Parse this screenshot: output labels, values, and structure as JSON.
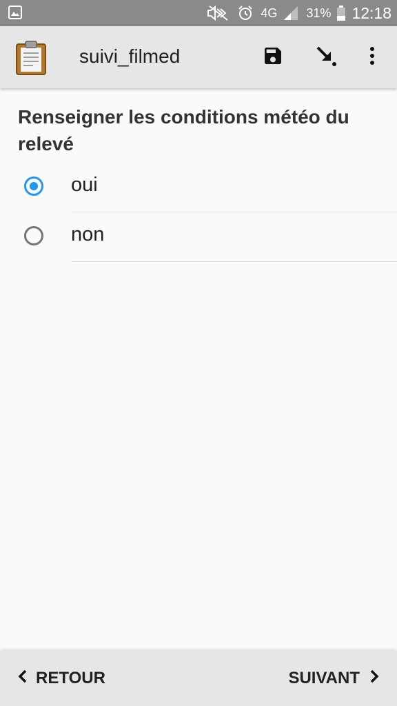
{
  "status_bar": {
    "network": "4G",
    "battery_percent": "31%",
    "time": "12:18",
    "icons": [
      "gallery-icon",
      "mute-icon",
      "alarm-icon",
      "signal-icon",
      "battery-icon"
    ]
  },
  "app_bar": {
    "title": "suivi_filmed",
    "icons": [
      "clipboard-icon",
      "save-icon",
      "go-to-icon",
      "more-vert-icon"
    ]
  },
  "form": {
    "question": "Renseigner les conditions météo du relevé",
    "options": [
      {
        "label": "oui",
        "selected": true
      },
      {
        "label": "non",
        "selected": false
      }
    ]
  },
  "nav": {
    "back_label": "RETOUR",
    "next_label": "SUIVANT"
  },
  "colors": {
    "accent": "#2196f3",
    "status_bar": "#8a8a8a",
    "app_bar": "#e6e6e6",
    "background": "#fafafa"
  }
}
